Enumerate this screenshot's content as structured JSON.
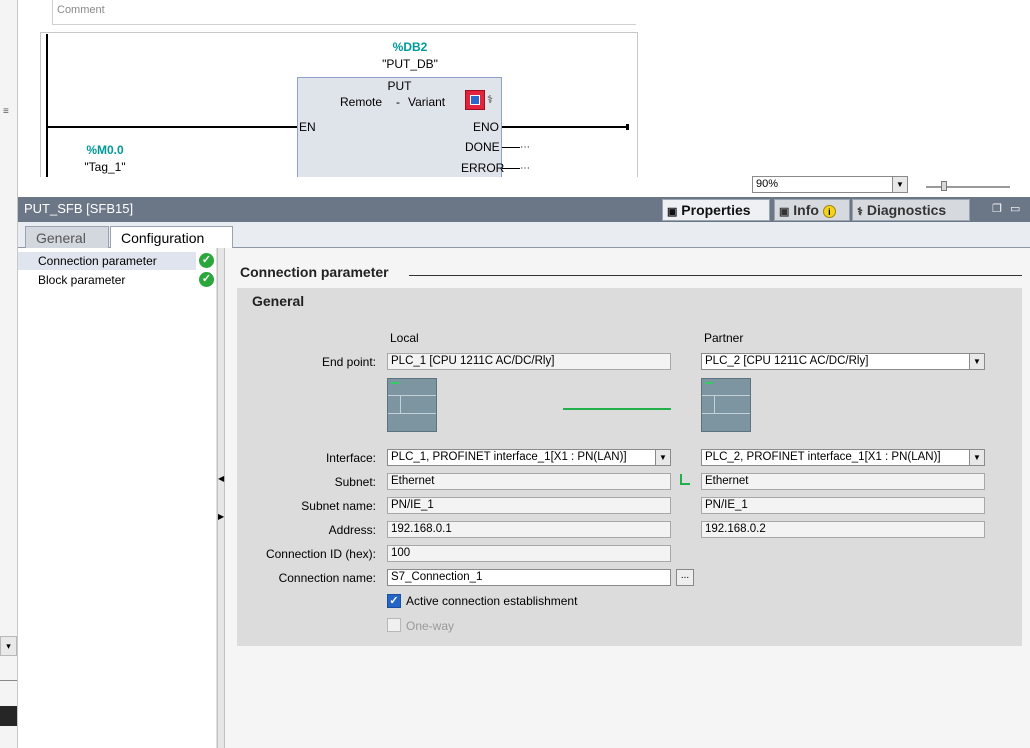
{
  "editor": {
    "comment": "Comment",
    "db_address": "%DB2",
    "db_name": "\"PUT_DB\"",
    "block_title": "PUT",
    "block_mode": "Remote",
    "block_sep": "-",
    "block_variant": "Variant",
    "pin_en": "EN",
    "pin_eno": "ENO",
    "pin_done": "DONE",
    "pin_error": "ERROR",
    "tag_address": "%M0.0",
    "tag_name": "\"Tag_1\"",
    "zoom": "90%"
  },
  "properties": {
    "title": "PUT_SFB [SFB15]",
    "tabs": [
      "Properties",
      "Info",
      "Diagnostics"
    ],
    "subtabs": [
      "General",
      "Configuration"
    ],
    "nav": [
      "Connection parameter",
      "Block parameter"
    ],
    "section_title": "Connection parameter",
    "group_title": "General",
    "col_local": "Local",
    "col_partner": "Partner",
    "labels": {
      "end_point": "End point:",
      "interface": "Interface:",
      "subnet": "Subnet:",
      "subnet_name": "Subnet name:",
      "address": "Address:",
      "connection_id": "Connection ID (hex):",
      "connection_name": "Connection name:"
    },
    "local": {
      "end_point": "PLC_1 [CPU 1211C AC/DC/Rly]",
      "interface": "PLC_1, PROFINET interface_1[X1 : PN(LAN)]",
      "subnet": "Ethernet",
      "subnet_name": "PN/IE_1",
      "address": "192.168.0.1",
      "connection_id": "100",
      "connection_name": "S7_Connection_1"
    },
    "partner": {
      "end_point": "PLC_2 [CPU 1211C AC/DC/Rly]",
      "interface": "PLC_2, PROFINET interface_1[X1 : PN(LAN)]",
      "subnet": "Ethernet",
      "subnet_name": "PN/IE_1",
      "address": "192.168.0.2"
    },
    "browse": "...",
    "active_connection": "Active connection establishment",
    "one_way": "One-way"
  },
  "colors": {
    "header": "#6b7687",
    "teal": "#00999a",
    "check_green": "#2aa63a",
    "link_green": "#22b04a"
  }
}
